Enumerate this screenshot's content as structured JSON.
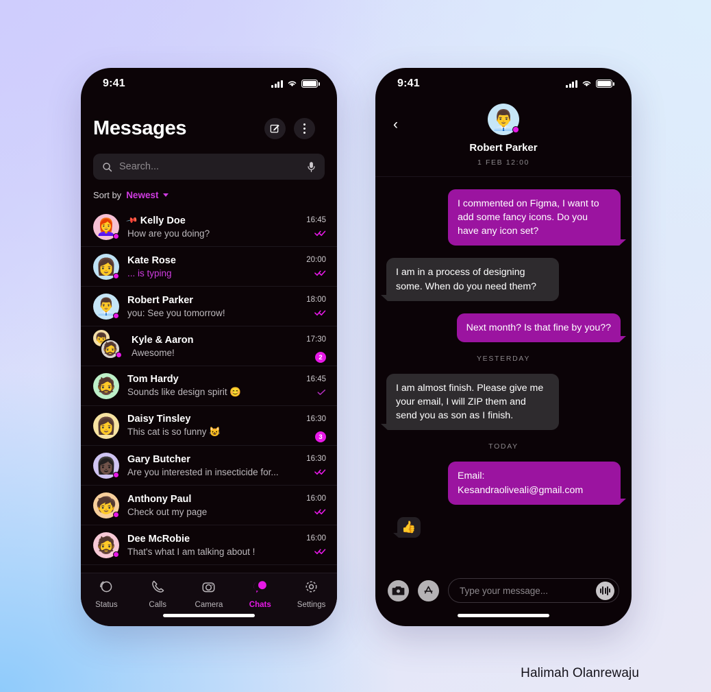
{
  "canvas": {
    "credit": "Halimah Olanrewaju",
    "accent": "#e619e6",
    "bubble_out": "#9b14a0",
    "bubble_in": "#2e2b2e"
  },
  "left_phone": {
    "status": {
      "time": "9:41",
      "signal_icon": "cellular-bars-icon",
      "wifi_icon": "wifi-icon",
      "battery_icon": "battery-full-icon"
    },
    "header": {
      "title": "Messages",
      "compose_icon": "compose-pencil-icon",
      "more_icon": "kebab-menu-icon"
    },
    "search": {
      "placeholder": "Search...",
      "search_icon": "search-icon",
      "mic_icon": "microphone-icon"
    },
    "sort": {
      "label": "Sort by",
      "value": "Newest",
      "caret_icon": "chevron-down-icon"
    },
    "chats": [
      {
        "name": "Kelly Doe",
        "preview": "How are you doing?",
        "time": "16:45",
        "pinned": true,
        "typing": false,
        "online": true,
        "status": "read",
        "badge": "",
        "avatar_emoji": "👩‍🦰",
        "avatar_bg": "#f6c0d4"
      },
      {
        "name": "Kate Rose",
        "preview": "... is typing",
        "time": "20:00",
        "pinned": false,
        "typing": true,
        "online": true,
        "status": "read",
        "badge": "",
        "avatar_emoji": "👩",
        "avatar_bg": "#bfe2f5"
      },
      {
        "name": "Robert Parker",
        "preview": "you: See you tomorrow!",
        "time": "18:00",
        "pinned": false,
        "typing": false,
        "online": true,
        "status": "read",
        "badge": "",
        "avatar_emoji": "👨‍💼",
        "avatar_bg": "#c6e6f7"
      },
      {
        "name": "Kyle & Aaron",
        "preview": "Awesome!",
        "time": "17:30",
        "pinned": false,
        "typing": false,
        "online": true,
        "status": "badge",
        "badge": "2",
        "avatar_emoji": "👦",
        "avatar_emoji2": "🧔",
        "avatar_bg": "#f4dfa8",
        "avatar_bg2": "#d9d4cf",
        "group": true
      },
      {
        "name": "Tom Hardy",
        "preview": "Sounds like design spirit 😊",
        "time": "16:45",
        "pinned": false,
        "typing": false,
        "online": false,
        "status": "sent",
        "badge": "",
        "avatar_emoji": "🧔",
        "avatar_bg": "#bdf0c8"
      },
      {
        "name": "Daisy Tinsley",
        "preview": "This cat is so funny 😺",
        "time": "16:30",
        "pinned": false,
        "typing": false,
        "online": false,
        "status": "badge",
        "badge": "3",
        "avatar_emoji": "👩",
        "avatar_bg": "#f7e3a1"
      },
      {
        "name": "Gary Butcher",
        "preview": "Are you interested in insecticide for...",
        "time": "16:30",
        "pinned": false,
        "typing": false,
        "online": true,
        "status": "read",
        "badge": "",
        "avatar_emoji": "👩🏿",
        "avatar_bg": "#cfc4f2"
      },
      {
        "name": "Anthony Paul",
        "preview": "Check out my page",
        "time": "16:00",
        "pinned": false,
        "typing": false,
        "online": true,
        "status": "read",
        "badge": "",
        "avatar_emoji": "🧒",
        "avatar_bg": "#f7cf9b"
      },
      {
        "name": "Dee McRobie",
        "preview": "That's what I am talking about !",
        "time": "16:00",
        "pinned": false,
        "typing": false,
        "online": true,
        "status": "read",
        "badge": "",
        "avatar_emoji": "🧔",
        "avatar_bg": "#f7c9d6"
      }
    ],
    "tabs": [
      {
        "label": "Status",
        "icon": "status-rings-icon",
        "active": false
      },
      {
        "label": "Calls",
        "icon": "phone-icon",
        "active": false
      },
      {
        "label": "Camera",
        "icon": "camera-icon",
        "active": false
      },
      {
        "label": "Chats",
        "icon": "chat-bubbles-icon",
        "active": true
      },
      {
        "label": "Settings",
        "icon": "gear-icon",
        "active": false
      }
    ]
  },
  "right_phone": {
    "status": {
      "time": "9:41"
    },
    "header": {
      "back_icon": "chevron-left-icon",
      "contact_name": "Robert Parker",
      "timestamp": "1 FEB 12:00",
      "avatar_emoji": "👨‍💼",
      "online": true
    },
    "messages": [
      {
        "kind": "bubble",
        "side": "out",
        "text": "I commented on Figma, I want to add some fancy icons. Do you have any icon set?"
      },
      {
        "kind": "bubble",
        "side": "in",
        "text": "I am in a process of designing some. When do you need them?"
      },
      {
        "kind": "bubble",
        "side": "out",
        "text": "Next month? Is that fine by you??"
      },
      {
        "kind": "separator",
        "text": "YESTERDAY"
      },
      {
        "kind": "bubble",
        "side": "in",
        "text": "I am almost finish. Please give me your email, I will ZIP them and send you as son as I finish."
      },
      {
        "kind": "separator",
        "text": "TODAY"
      },
      {
        "kind": "bubble",
        "side": "out",
        "text": "Email: Kesandraoliveali@gmail.com"
      },
      {
        "kind": "reaction",
        "side": "in",
        "text": "👍"
      }
    ],
    "composer": {
      "camera_icon": "camera-icon",
      "appstore_icon": "app-store-icon",
      "placeholder": "Type your message...",
      "voice_icon": "voice-waveform-icon"
    }
  }
}
